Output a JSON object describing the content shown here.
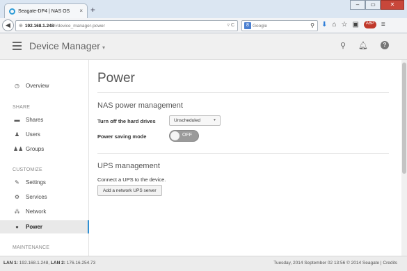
{
  "browser": {
    "tab_title": "Seagate-DP4 | NAS OS",
    "tab_close": "×",
    "new_tab": "+",
    "url_host": "192.168.1.248",
    "url_path": "/#device_manager-power",
    "search_placeholder": "Google",
    "window_controls": [
      "–",
      "▭",
      "✕"
    ]
  },
  "header": {
    "title": "Device Manager"
  },
  "sidebar": {
    "items_main": [
      {
        "label": "Overview",
        "icon": "clock-icon"
      }
    ],
    "section_share": "SHARE",
    "items_share": [
      {
        "label": "Shares",
        "icon": "folder-icon"
      },
      {
        "label": "Users",
        "icon": "user-icon"
      },
      {
        "label": "Groups",
        "icon": "group-icon"
      }
    ],
    "section_customize": "CUSTOMIZE",
    "items_customize": [
      {
        "label": "Settings",
        "icon": "wrench-icon"
      },
      {
        "label": "Services",
        "icon": "gears-icon"
      },
      {
        "label": "Network",
        "icon": "network-icon"
      },
      {
        "label": "Power",
        "icon": "lightbulb-icon",
        "active": true
      }
    ],
    "section_maintenance": "MAINTENANCE"
  },
  "main": {
    "title": "Power",
    "nas_heading": "NAS power management",
    "turn_off_label": "Turn off the hard drives",
    "turn_off_value": "Unscheduled",
    "power_saving_label": "Power saving mode",
    "power_saving_state": "OFF",
    "ups_heading": "UPS management",
    "ups_text": "Connect a UPS to the device.",
    "ups_button": "Add a network UPS server"
  },
  "footer": {
    "lan1_label": "LAN 1:",
    "lan1_value": "192.168.1.248,",
    "lan2_label": "LAN 2:",
    "lan2_value": "176.16.254.73",
    "datetime": "Tuesday, 2014 September 02   13:56",
    "copyright": "© 2014 Seagate | Credits"
  }
}
